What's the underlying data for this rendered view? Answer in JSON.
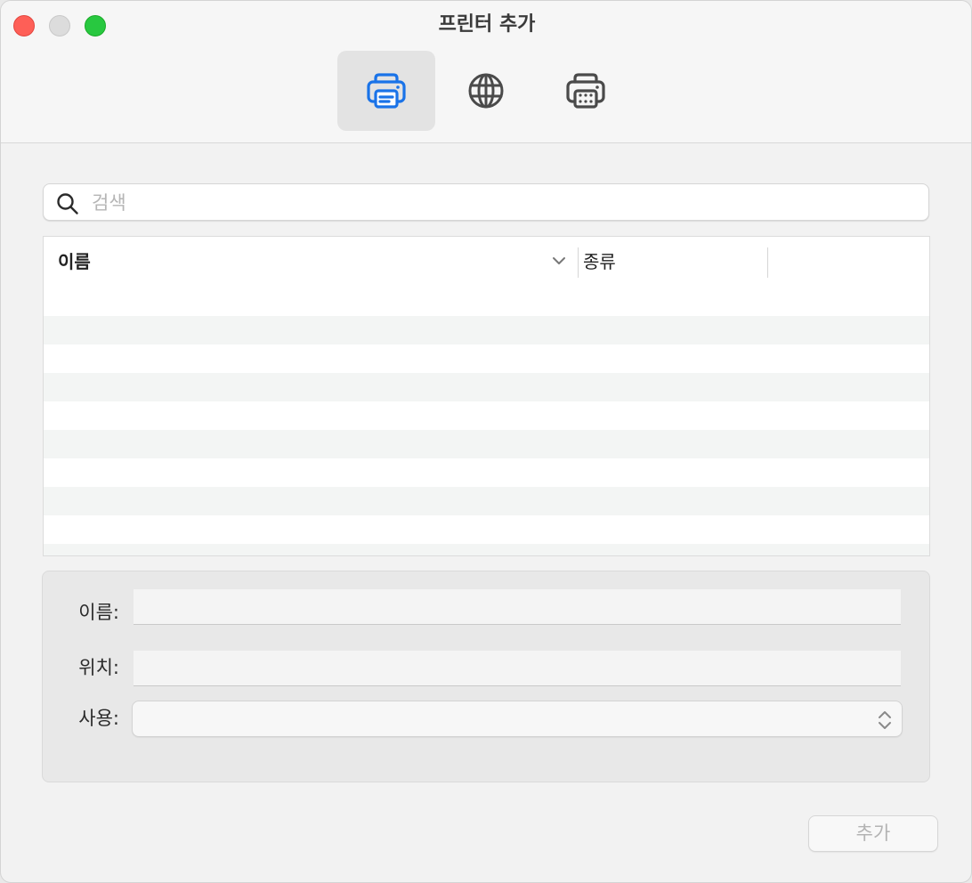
{
  "window": {
    "title": "프린터 추가"
  },
  "toolbar": {
    "tabs": [
      {
        "icon": "printer-icon",
        "active": true
      },
      {
        "icon": "globe-icon",
        "active": false
      },
      {
        "icon": "windows-printer-icon",
        "active": false
      }
    ]
  },
  "search": {
    "placeholder": "검색",
    "value": ""
  },
  "table": {
    "columns": [
      {
        "label": "이름",
        "sorted": true
      },
      {
        "label": "종류",
        "sorted": false
      }
    ],
    "rows": []
  },
  "details": {
    "name_label": "이름:",
    "name_value": "",
    "location_label": "위치:",
    "location_value": "",
    "use_label": "사용:",
    "use_value": ""
  },
  "actions": {
    "add_label": "추가",
    "add_enabled": false
  },
  "colors": {
    "accent": "#1a73e8",
    "close": "#fe5f57",
    "zoom": "#28c840"
  }
}
